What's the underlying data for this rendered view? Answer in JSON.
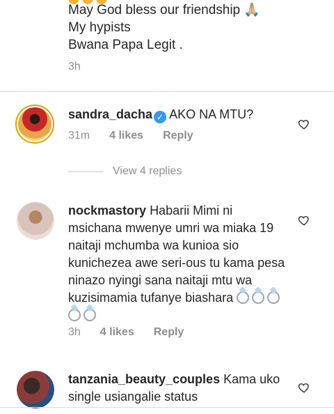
{
  "top_comment": {
    "lines": [
      "May God bless our friendship 🙏🏼",
      "My hypists",
      "Bwana  Papa Legit ."
    ],
    "time": "3h"
  },
  "comments": [
    {
      "username": "sandra_dacha",
      "verified": true,
      "text": "AKO NA MTU?",
      "time": "31m",
      "likes": "4 likes",
      "reply": "Reply",
      "view_replies": "View 4 replies"
    },
    {
      "username": "nockmastory",
      "text": "Habarii Mimi ni msichana mwenye umri wa miaka 19 naitaji mchumba wa kunioa sio kunichezea  awe seri-ous tu kama pesa ninazo nyingi sana naitaji mtu wa kuzisimamia tufanye biashara",
      "time": "3h",
      "likes": "4 likes",
      "reply": "Reply"
    },
    {
      "username": "tanzania_beauty_couples",
      "text": "Kama uko single usiangalie status"
    }
  ],
  "icons": {
    "heart": "heart-outline-icon",
    "verified": "verified-badge-icon",
    "ring": "ring-emoji-icon"
  },
  "colors": {
    "text": "#262626",
    "muted": "#8e8e8e",
    "verified": "#3897f0",
    "divider": "#dbdbdb"
  }
}
